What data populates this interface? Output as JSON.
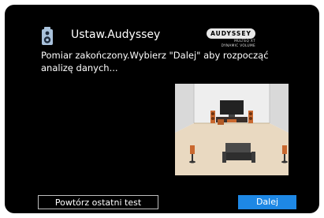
{
  "header": {
    "title": "Ustaw.Audyssey",
    "icon": "speaker-icon"
  },
  "logo": {
    "brand": "AUDYSSEY",
    "line1": "MULTEQ XT",
    "line2": "DYNAMIC VOLUME"
  },
  "message": "Pomiar zakończony.Wybierz \"Dalej\" aby rozpocząć analizę danych...",
  "illustration": {
    "icon": "room-speakers-icon"
  },
  "buttons": {
    "retry_label": "Powtórz ostatni test",
    "next_label": "Dalej"
  },
  "colors": {
    "background": "#000000",
    "accent": "#1e88e5",
    "text": "#ffffff"
  }
}
